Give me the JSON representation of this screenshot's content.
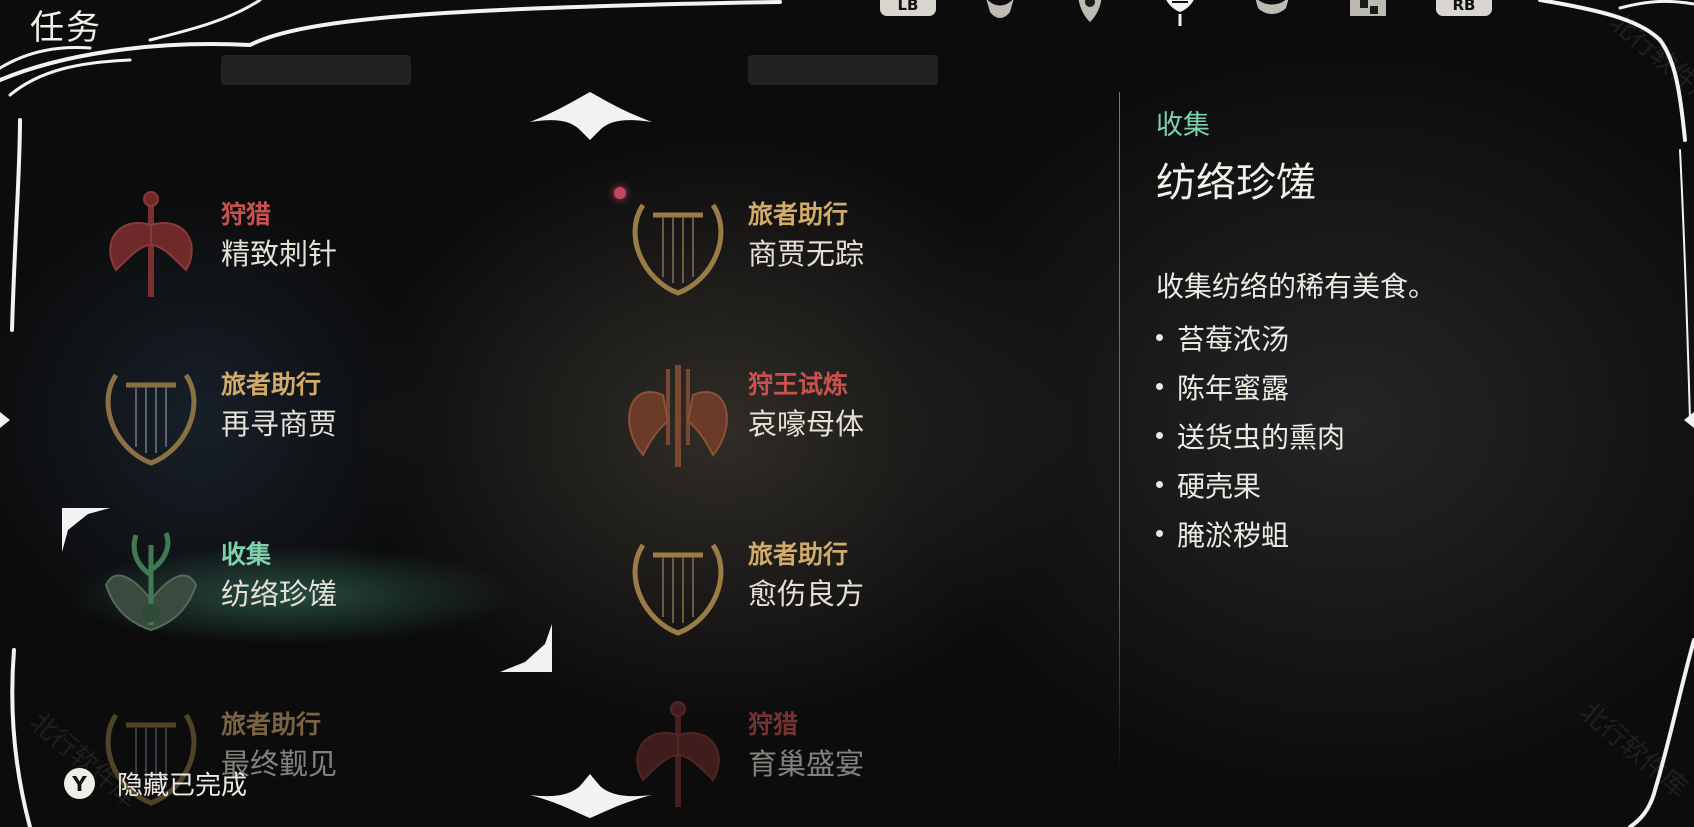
{
  "header": {
    "title": "任务"
  },
  "tabs": {
    "lb_label": "LB",
    "rb_label": "RB"
  },
  "quests": [
    {
      "category": "狩猎",
      "name": "精致刺针",
      "category_color": "#c9524e"
    },
    {
      "category": "旅者助行",
      "name": "商贾无踪",
      "category_color": "#d2aa6a"
    },
    {
      "category": "旅者助行",
      "name": "再寻商贾",
      "category_color": "#d2aa6a"
    },
    {
      "category": "狩王试炼",
      "name": "哀嚎母体",
      "category_color": "#c9524e"
    },
    {
      "category": "收集",
      "name": "纺络珍馐",
      "category_color": "#7fd1ae"
    },
    {
      "category": "旅者助行",
      "name": "愈伤良方",
      "category_color": "#d2aa6a"
    },
    {
      "category": "旅者助行",
      "name": "最终觐见",
      "category_color": "#d2aa6a"
    },
    {
      "category": "狩猎",
      "name": "育巢盛宴",
      "category_color": "#c9524e"
    }
  ],
  "detail": {
    "category": "收集",
    "title": "纺络珍馐",
    "description": "收集纺络的稀有美食。",
    "items": [
      "苔莓浓汤",
      "陈年蜜露",
      "送货虫的熏肉",
      "硬壳果",
      "腌淤秽蛆"
    ]
  },
  "footer": {
    "button": "Y",
    "label": "隐藏已完成"
  },
  "colors": {
    "hunt": "#c9524e",
    "traveler": "#d2aa6a",
    "collect": "#7fd1ae"
  }
}
